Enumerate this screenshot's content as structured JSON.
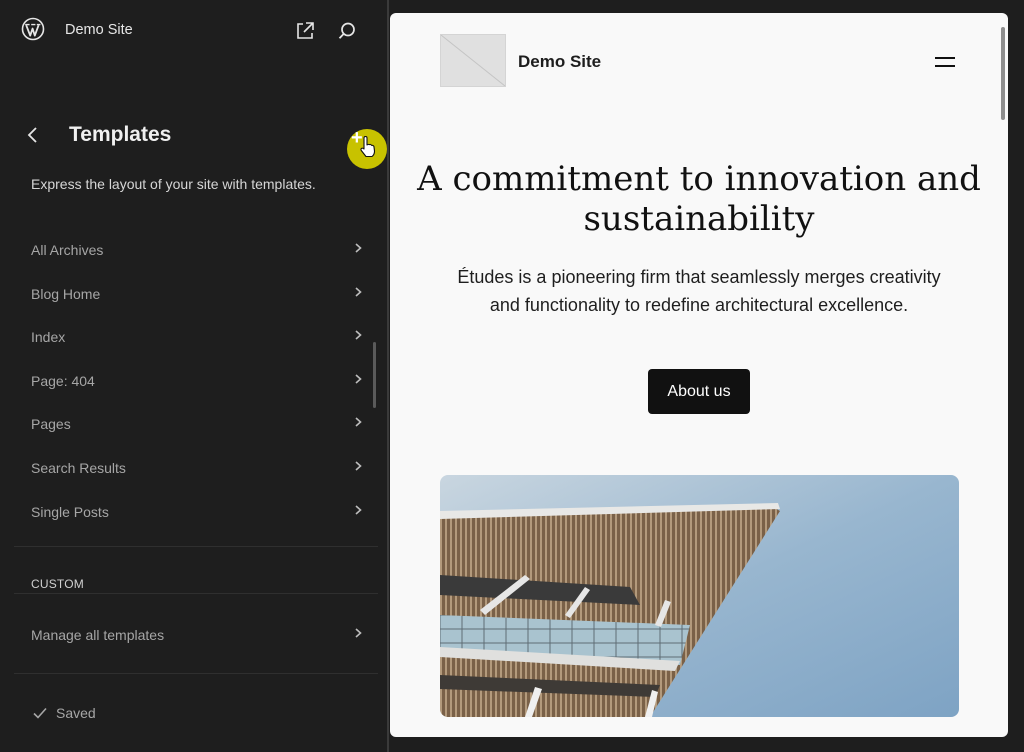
{
  "header": {
    "site_name": "Demo Site"
  },
  "icons": {
    "logo": "wordpress-logo-icon",
    "view": "external-link-icon",
    "search": "search-icon",
    "back": "chevron-left-icon",
    "add": "plus-icon"
  },
  "panel": {
    "title": "Templates",
    "description": "Express the layout of your site with templates.",
    "items": [
      {
        "label": "All Archives"
      },
      {
        "label": "Blog Home"
      },
      {
        "label": "Index"
      },
      {
        "label": "Page: 404"
      },
      {
        "label": "Pages"
      },
      {
        "label": "Search Results"
      },
      {
        "label": "Single Posts"
      }
    ],
    "custom_section": {
      "heading": "CUSTOM",
      "items": [
        {
          "label": "Manage all templates"
        }
      ]
    }
  },
  "footer": {
    "status": "Saved"
  },
  "preview": {
    "site_name": "Demo Site",
    "hero_title": "A commitment to innovation and sustainability",
    "hero_text": "Études is a pioneering firm that seamlessly merges creativity and functionality to redefine architectural excellence.",
    "button_label": "About us"
  },
  "colors": {
    "sidebar_bg": "#1e1e1e",
    "accent_add": "#c8c200",
    "preview_bg": "#f9f9f9",
    "button_bg": "#111111"
  }
}
